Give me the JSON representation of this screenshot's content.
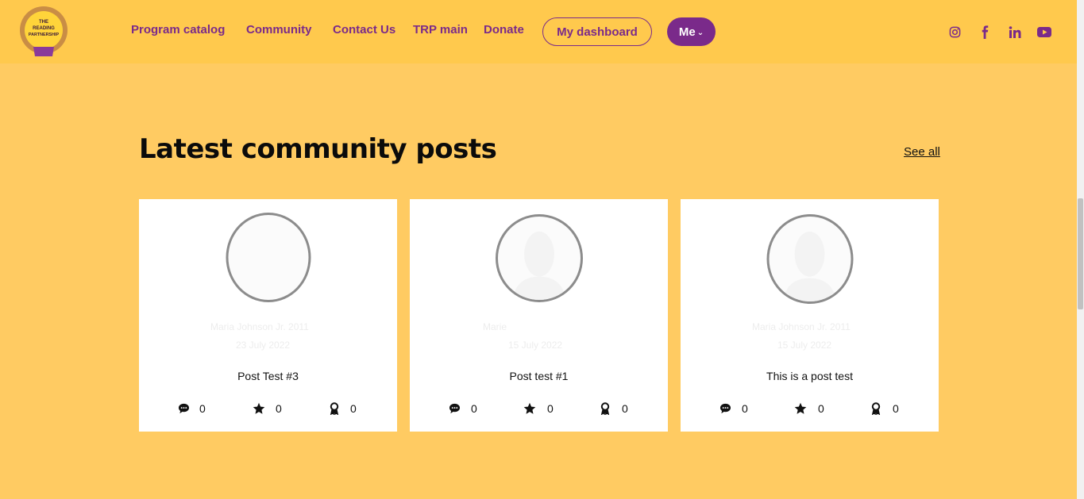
{
  "header": {
    "logo": {
      "text_line1": "THE",
      "text_line2": "READING",
      "text_line3": "PARTNERSHIP"
    },
    "nav": [
      {
        "label": "Program catalog"
      },
      {
        "label": "Community"
      },
      {
        "label": "Contact Us"
      },
      {
        "label": "TRP main"
      },
      {
        "label": "Donate"
      }
    ],
    "dashboard_label": "My dashboard",
    "me_label": "Me",
    "social_icons": [
      "instagram-icon",
      "facebook-icon",
      "linkedin-icon",
      "youtube-icon"
    ],
    "colors": {
      "accent": "#7a2a8a",
      "header_bg": "#ffc94d",
      "page_bg": "#ffcb62"
    }
  },
  "section": {
    "title": "Latest community posts",
    "see_all": "See all"
  },
  "cards": [
    {
      "author": "Maria Johnson Jr. 2011",
      "date": "23 July 2022",
      "title": "Post Test #3",
      "comments": "0",
      "stars": "0",
      "awards": "0"
    },
    {
      "author": "Marie",
      "date": "15 July 2022",
      "title": "Post test #1",
      "comments": "0",
      "stars": "0",
      "awards": "0"
    },
    {
      "author": "Maria Johnson Jr. 2011",
      "date": "15 July 2022",
      "title": "This is a post test",
      "comments": "0",
      "stars": "0",
      "awards": "0"
    }
  ]
}
